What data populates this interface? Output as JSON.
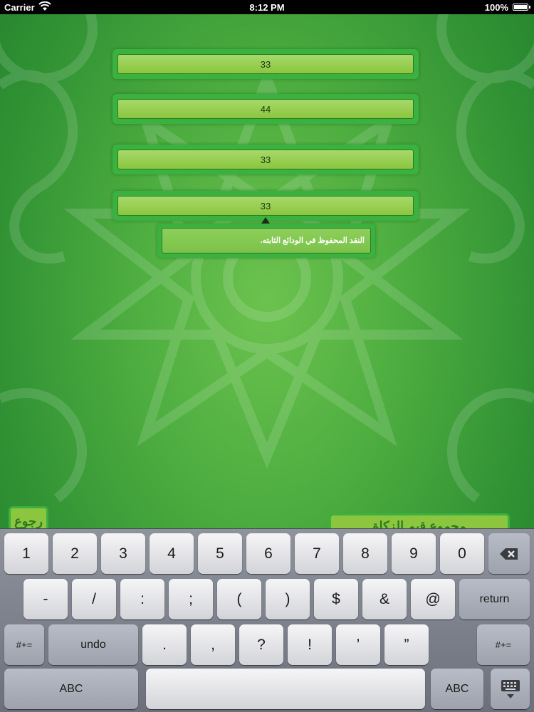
{
  "status_bar": {
    "carrier": "Carrier",
    "time": "8:12 PM",
    "battery": "100%"
  },
  "fields": [
    {
      "value": "33"
    },
    {
      "value": "44"
    },
    {
      "value": "33"
    },
    {
      "value": "33"
    }
  ],
  "tooltip": {
    "text": "النقد المحفوظ في الودائع الثابته."
  },
  "buttons": {
    "back_label": "رجوع",
    "bottom_label": "مجموع قيم الزكاة"
  },
  "keyboard": {
    "row1": [
      "1",
      "2",
      "3",
      "4",
      "5",
      "6",
      "7",
      "8",
      "9",
      "0"
    ],
    "row2": [
      "-",
      "/",
      ":",
      ";",
      "(",
      ")",
      "$",
      "&",
      "@"
    ],
    "return_label": "return",
    "alt_symbols_label": "#+=",
    "undo_label": "undo",
    "row3": [
      ".",
      ",",
      "?",
      "!",
      "’",
      "”"
    ],
    "abc_label": "ABC",
    "space_label": ""
  },
  "icons": {
    "wifi": "wifi-icon",
    "battery": "battery-icon",
    "delete": "delete-key-icon",
    "dismiss": "keyboard-dismiss-icon",
    "tooltip_arrow": "caret-up-icon"
  },
  "colors": {
    "accent": "#8cc63f",
    "frame": "#3bb140",
    "background": "#4eae40"
  }
}
